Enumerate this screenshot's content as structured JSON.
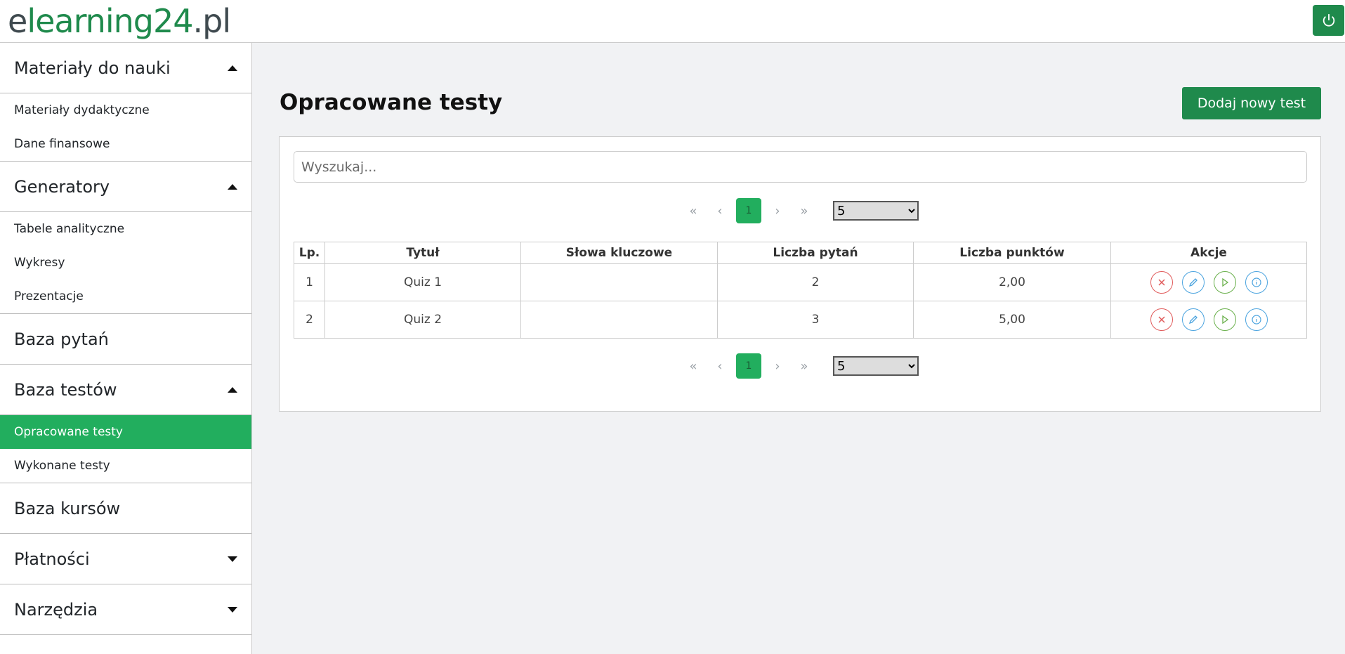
{
  "header": {
    "logo_dark_prefix": "e",
    "logo_green": "learning",
    "logo_dark_mid": "24",
    "logo_suffix": ".pl",
    "power_icon": "power-icon"
  },
  "sidebar": {
    "sections": [
      {
        "label": "Materiały do nauki",
        "state": "expanded",
        "items": [
          "Materiały dydaktyczne",
          "Dane finansowe"
        ]
      },
      {
        "label": "Generatory",
        "state": "expanded",
        "items": [
          "Tabele analityczne",
          "Wykresy",
          "Prezentacje"
        ]
      },
      {
        "label": "Baza pytań",
        "state": "none",
        "items": []
      },
      {
        "label": "Baza testów",
        "state": "expanded",
        "items": [
          "Opracowane testy",
          "Wykonane testy"
        ],
        "active_item": "Opracowane testy"
      },
      {
        "label": "Baza kursów",
        "state": "none",
        "items": []
      },
      {
        "label": "Płatności",
        "state": "collapsed",
        "items": []
      },
      {
        "label": "Narzędzia",
        "state": "collapsed",
        "items": []
      }
    ]
  },
  "main": {
    "title": "Opracowane testy",
    "add_button": "Dodaj nowy test",
    "search_placeholder": "Wyszukaj...",
    "pagination": {
      "first": "«",
      "prev": "‹",
      "current": "1",
      "next": "›",
      "last": "»",
      "page_size": "5",
      "page_size_options": [
        "5"
      ]
    },
    "table": {
      "headers": [
        "Lp.",
        "Tytuł",
        "Słowa kluczowe",
        "Liczba pytań",
        "Liczba punktów",
        "Akcje"
      ],
      "rows": [
        {
          "lp": "1",
          "title": "Quiz 1",
          "keywords": "",
          "questions": "2",
          "points": "2,00"
        },
        {
          "lp": "2",
          "title": "Quiz 2",
          "keywords": "",
          "questions": "3",
          "points": "5,00"
        }
      ],
      "action_icons": [
        "delete-icon",
        "edit-icon",
        "play-icon",
        "info-icon"
      ]
    }
  },
  "colors": {
    "brand_green": "#1f8a4c",
    "active_green": "#22ae5e",
    "delete_red": "#e05a5a",
    "edit_blue": "#4aa3df",
    "run_green": "#6ab04c"
  }
}
